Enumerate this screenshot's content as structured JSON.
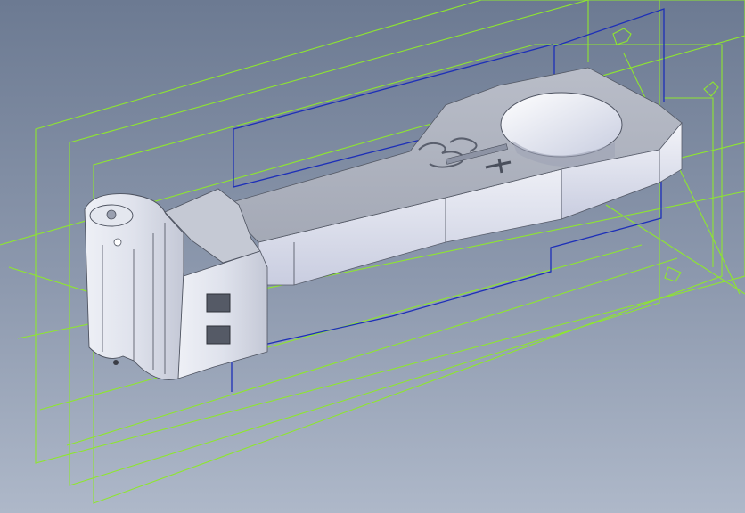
{
  "viewport": {
    "background_top": "#6c7a92",
    "background_bottom": "#aeb8c9",
    "datum_plane_color": "#8ee62f",
    "sketch_color": "#1d2fb8",
    "part_color": "#d4d8e4"
  },
  "part": {
    "type": "connecting-rod",
    "embossed_marks": [
      "3",
      "+"
    ]
  }
}
